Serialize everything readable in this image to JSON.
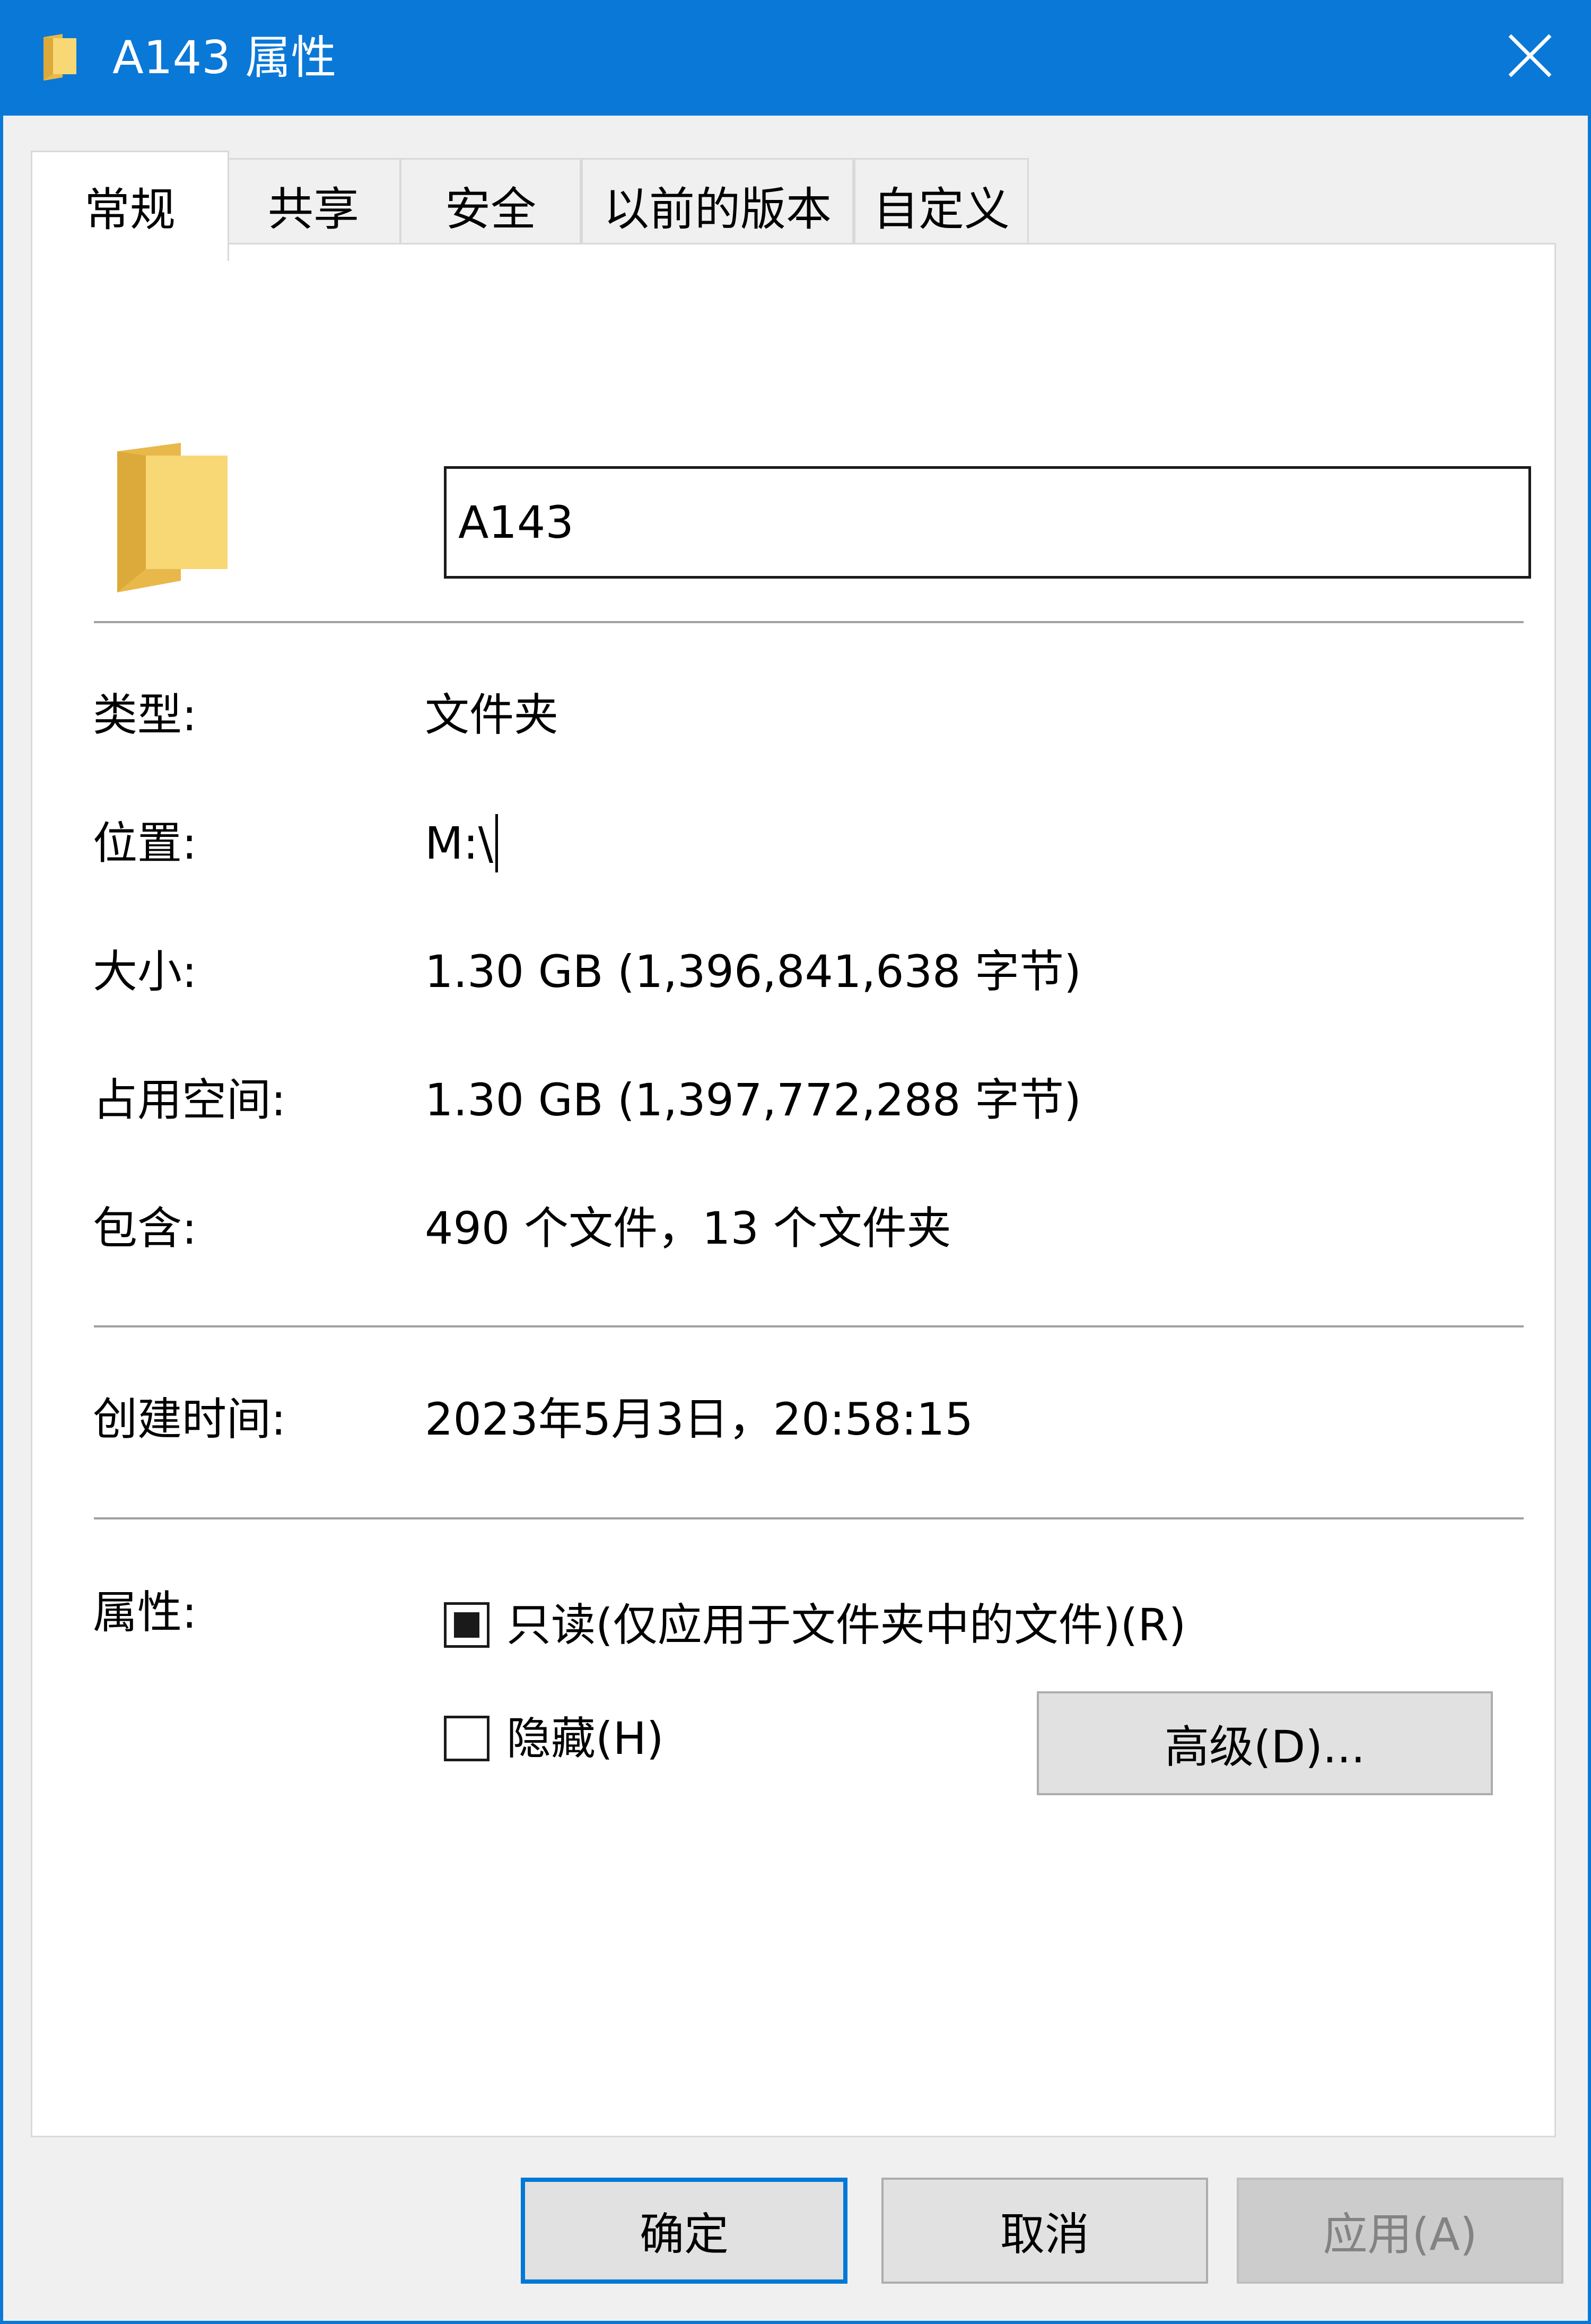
{
  "window": {
    "title": "A143 属性",
    "close_symbol": "✕",
    "accent_color": "#0078d7"
  },
  "tabs": [
    {
      "label": "常规",
      "active": true
    },
    {
      "label": "共享",
      "active": false
    },
    {
      "label": "安全",
      "active": false
    },
    {
      "label": "以前的版本",
      "active": false
    },
    {
      "label": "自定义",
      "active": false
    }
  ],
  "general": {
    "name_value": "A143",
    "rows": [
      {
        "label": "类型:",
        "value": "文件夹"
      },
      {
        "label": "位置:",
        "value": "M:\\"
      },
      {
        "label": "大小:",
        "value": "1.30 GB (1,396,841,638 字节)"
      },
      {
        "label": "占用空间:",
        "value": "1.30 GB (1,397,772,288 字节)"
      },
      {
        "label": "包含:",
        "value": "490 个文件，13 个文件夹"
      }
    ],
    "created": {
      "label": "创建时间:",
      "value": "2023年5月3日，20:58:15"
    },
    "attributes": {
      "label": "属性:",
      "readonly": {
        "label": "只读(仅应用于文件夹中的文件)(R)",
        "state": "indeterminate"
      },
      "hidden": {
        "label": "隐藏(H)",
        "state": "unchecked"
      },
      "advanced_button": "高级(D)..."
    }
  },
  "footer": {
    "ok": "确定",
    "cancel": "取消",
    "apply": "应用(A)",
    "apply_disabled": true
  }
}
